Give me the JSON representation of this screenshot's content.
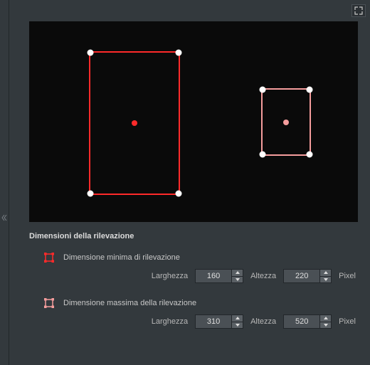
{
  "section_title": "Dimensioni della rilevazione",
  "min": {
    "label": "Dimensione minima di rilevazione",
    "width_label": "Larghezza",
    "width_value": "160",
    "height_label": "Altezza",
    "height_value": "220",
    "unit": "Pixel"
  },
  "max": {
    "label": "Dimensione massima della rilevazione",
    "width_label": "Larghezza",
    "width_value": "310",
    "height_label": "Altezza",
    "height_value": "520",
    "unit": "Pixel"
  }
}
